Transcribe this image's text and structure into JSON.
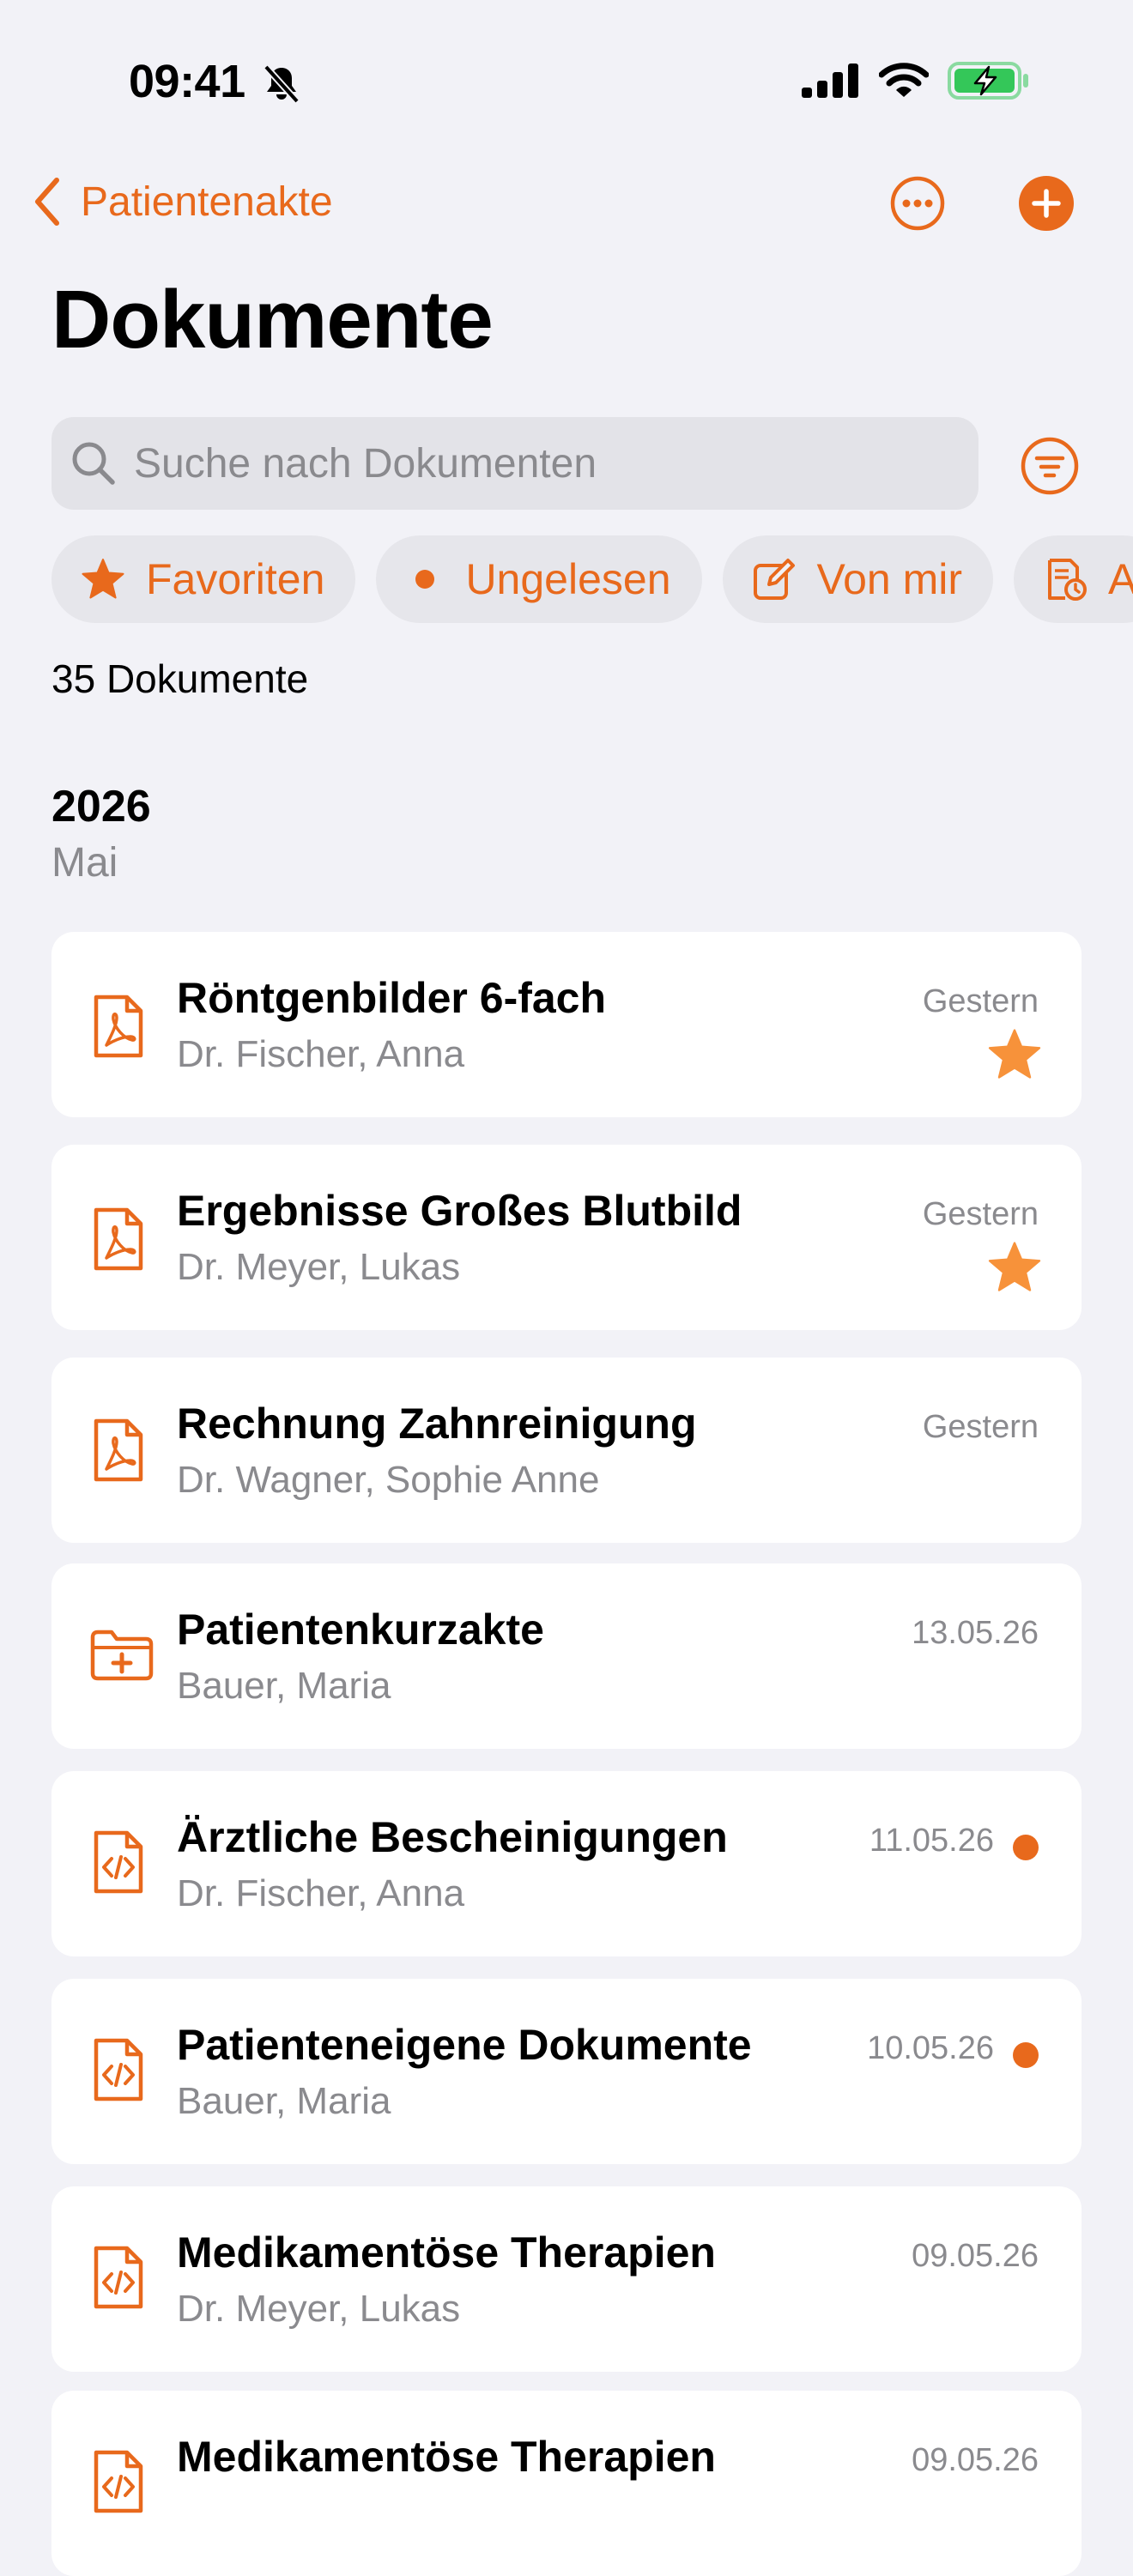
{
  "status": {
    "time": "09:41"
  },
  "nav": {
    "back_label": "Patientenakte"
  },
  "page": {
    "title": "Dokumente"
  },
  "search": {
    "placeholder": "Suche nach Dokumenten"
  },
  "chips": [
    {
      "label": "Favoriten",
      "icon": "star-icon"
    },
    {
      "label": "Ungelesen",
      "icon": "dot-icon"
    },
    {
      "label": "Von mir",
      "icon": "edit-icon"
    },
    {
      "label": "A",
      "icon": "document-clock-icon"
    }
  ],
  "summary": {
    "count": "35 Dokumente"
  },
  "section": {
    "year": "2026",
    "month": "Mai"
  },
  "documents": [
    {
      "title": "Röntgenbilder 6-fach",
      "author": "Dr. Fischer, Anna",
      "date": "Gestern",
      "icon": "pdf-icon",
      "favorite": true,
      "unread": false
    },
    {
      "title": "Ergebnisse Großes Blutbild",
      "author": "Dr. Meyer, Lukas",
      "date": "Gestern",
      "icon": "pdf-icon",
      "favorite": true,
      "unread": false
    },
    {
      "title": "Rechnung Zahnreinigung",
      "author": "Dr. Wagner, Sophie Anne",
      "date": "Gestern",
      "icon": "pdf-icon",
      "favorite": false,
      "unread": false
    },
    {
      "title": "Patientenkurzakte",
      "author": "Bauer, Maria",
      "date": "13.05.26",
      "icon": "medical-folder-icon",
      "favorite": false,
      "unread": false
    },
    {
      "title": "Ärztliche Bescheinigungen",
      "author": "Dr. Fischer, Anna",
      "date": "11.05.26",
      "icon": "code-document-icon",
      "favorite": false,
      "unread": true
    },
    {
      "title": "Patienteneigene Dokumente",
      "author": "Bauer, Maria",
      "date": "10.05.26",
      "icon": "code-document-icon",
      "favorite": false,
      "unread": true
    },
    {
      "title": "Medikamentöse Therapien",
      "author": "Dr. Meyer, Lukas",
      "date": "09.05.26",
      "icon": "code-document-icon",
      "favorite": false,
      "unread": false
    },
    {
      "title": "Medikamentöse Therapien",
      "author": "",
      "date": "09.05.26",
      "icon": "code-document-icon",
      "favorite": false,
      "unread": false
    }
  ],
  "colors": {
    "accent": "#e8691c",
    "star": "#f7923a",
    "background": "#f2f2f7",
    "secondary_text": "#8a8a8e"
  }
}
